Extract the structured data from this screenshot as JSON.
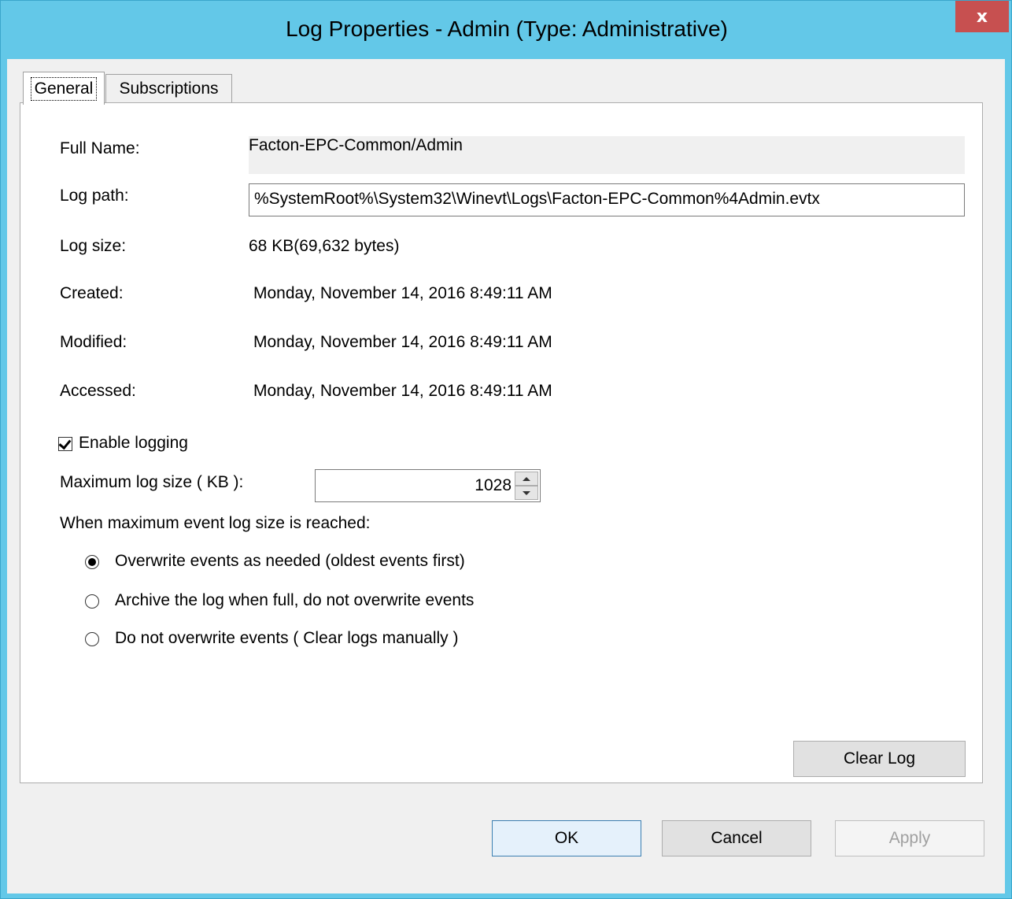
{
  "window": {
    "title": "Log Properties - Admin (Type: Administrative)",
    "close_label": "x"
  },
  "tabs": [
    {
      "label": "General",
      "selected": true
    },
    {
      "label": "Subscriptions",
      "selected": false
    }
  ],
  "general": {
    "full_name_label": "Full Name:",
    "full_name_value": "Facton-EPC-Common/Admin",
    "log_path_label": "Log path:",
    "log_path_value": "%SystemRoot%\\System32\\Winevt\\Logs\\Facton-EPC-Common%4Admin.evtx",
    "log_size_label": "Log size:",
    "log_size_value": "68 KB(69,632 bytes)",
    "created_label": "Created:",
    "created_value": "Monday, November 14, 2016 8:49:11 AM",
    "modified_label": "Modified:",
    "modified_value": "Monday, November 14, 2016 8:49:11 AM",
    "accessed_label": "Accessed:",
    "accessed_value": "Monday, November 14, 2016 8:49:11 AM",
    "enable_logging_label": "Enable logging",
    "enable_logging_checked": true,
    "max_size_label": "Maximum log size ( KB ):",
    "max_size_value": "1028",
    "when_reached_label": "When maximum event log size is reached:",
    "options": [
      {
        "label": "Overwrite events as needed (oldest events first)",
        "selected": true
      },
      {
        "label": "Archive the log when full, do not overwrite events",
        "selected": false
      },
      {
        "label": "Do not overwrite events ( Clear logs manually )",
        "selected": false
      }
    ],
    "clear_log_label": "Clear Log"
  },
  "footer": {
    "ok_label": "OK",
    "cancel_label": "Cancel",
    "apply_label": "Apply"
  }
}
